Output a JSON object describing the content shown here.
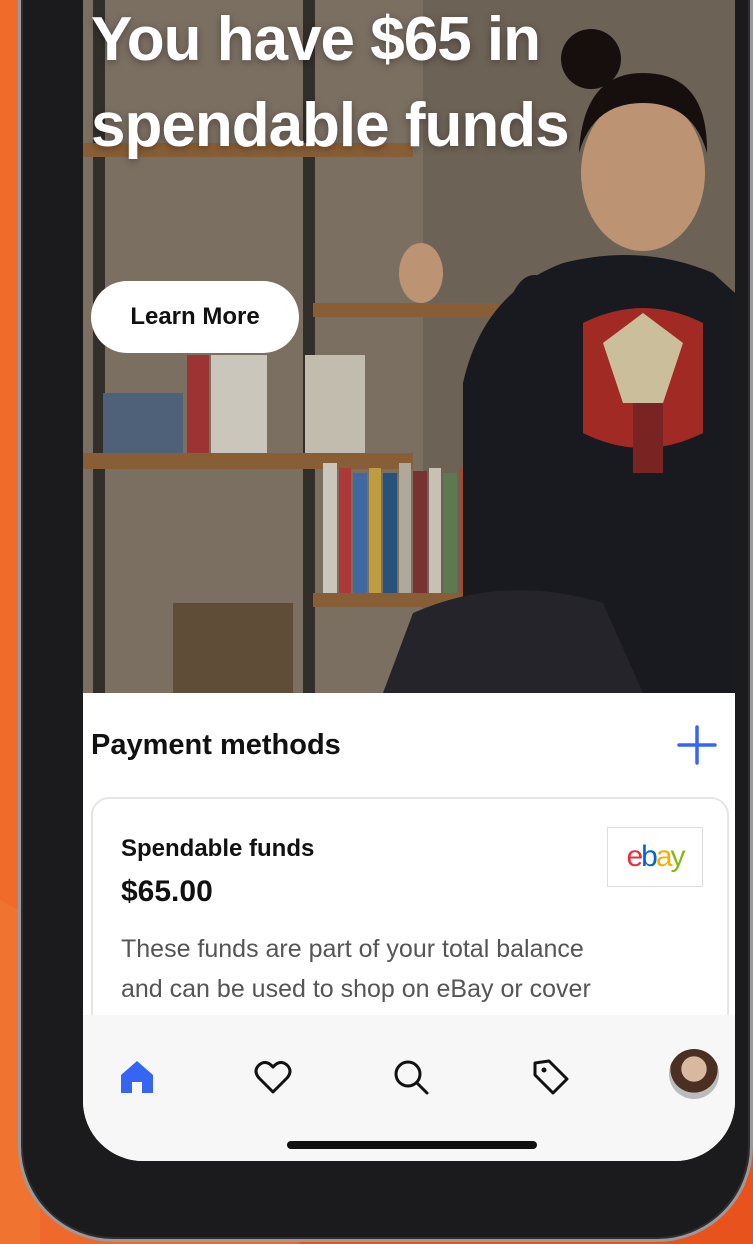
{
  "hero": {
    "title": "You have $65 in spendable funds",
    "learn_more_label": "Learn More"
  },
  "payment_methods": {
    "section_title": "Payment methods",
    "add_icon": "plus-icon",
    "card": {
      "title": "Spendable funds",
      "amount": "$65.00",
      "description": "These funds are part of your total balance and can be used to shop on eBay or cover selling costs",
      "logo_text": "ebay",
      "logo_colors": [
        "#e53238",
        "#0064d2",
        "#f5af02",
        "#86b817"
      ]
    }
  },
  "tabbar": {
    "items": [
      {
        "icon": "home-icon",
        "active": true
      },
      {
        "icon": "heart-icon",
        "active": false
      },
      {
        "icon": "search-icon",
        "active": false
      },
      {
        "icon": "tag-icon",
        "active": false
      },
      {
        "icon": "avatar",
        "active": false
      }
    ]
  },
  "colors": {
    "accent": "#3665f3",
    "background": "#e8521c"
  }
}
